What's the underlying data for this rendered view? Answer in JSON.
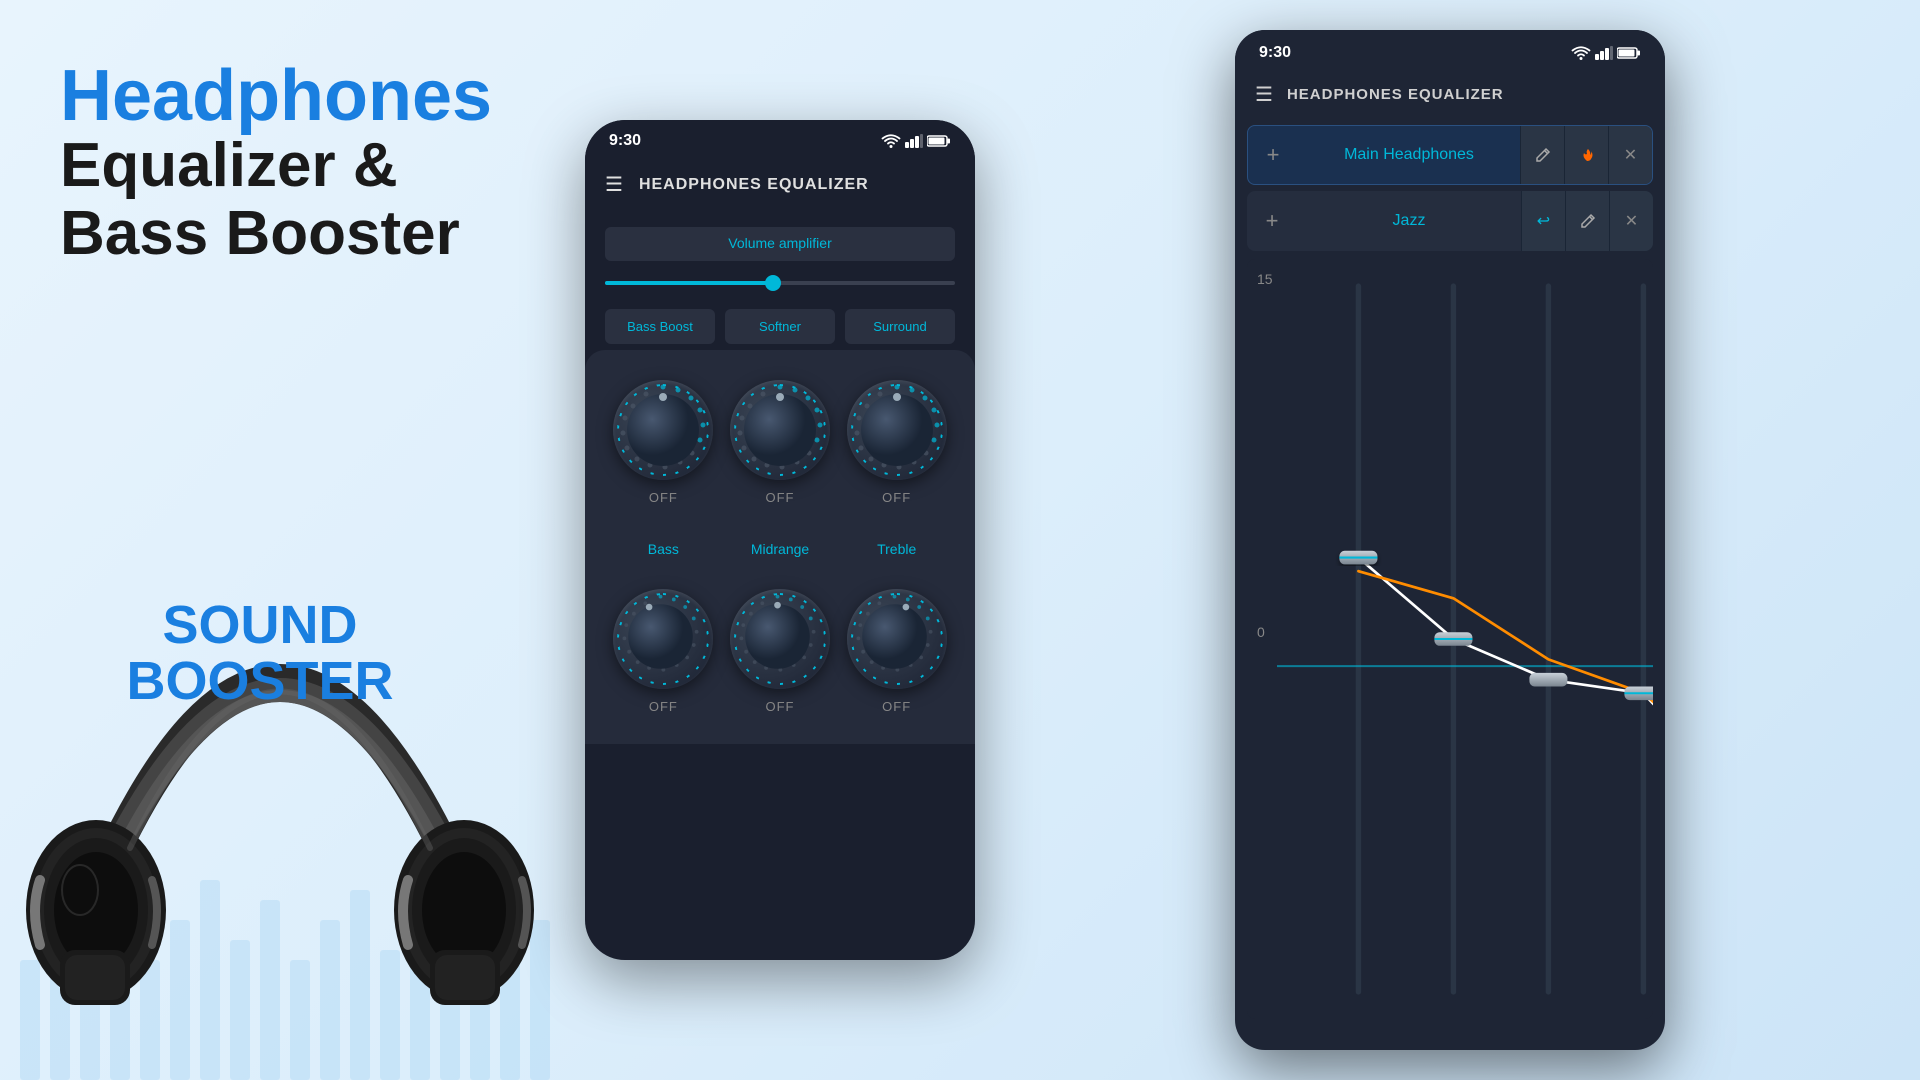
{
  "left": {
    "title_blue": "Headphones",
    "title_black": "Equalizer & Bass Booster",
    "sound_booster": "SOUND BOOSTER"
  },
  "phone1": {
    "time": "9:30",
    "header_title": "HEADPHONES EQUALIZER",
    "volume_label": "Volume amplifier",
    "buttons": {
      "bass_boost": "Bass Boost",
      "softner": "Softner",
      "surround": "Surround"
    },
    "knobs_row1": {
      "label1": "OFF",
      "label2": "OFF",
      "label3": "OFF"
    },
    "eq_labels": {
      "bass": "Bass",
      "midrange": "Midrange",
      "treble": "Treble"
    },
    "knobs_row2": {
      "label1": "OFF",
      "label2": "OFF",
      "label3": "OFF"
    }
  },
  "phone2": {
    "time": "9:30",
    "header_title": "HEADPHONES EQUALIZER",
    "preset1": {
      "name": "Main Headphones",
      "actions": {
        "pencil": "✏",
        "flame": "🔥",
        "close": "✕"
      }
    },
    "preset2": {
      "name": "Jazz",
      "actions": {
        "undo": "↩",
        "pencil": "✏",
        "close": "✕"
      }
    },
    "eq_scale_top": "15",
    "eq_scale_mid": "0"
  }
}
